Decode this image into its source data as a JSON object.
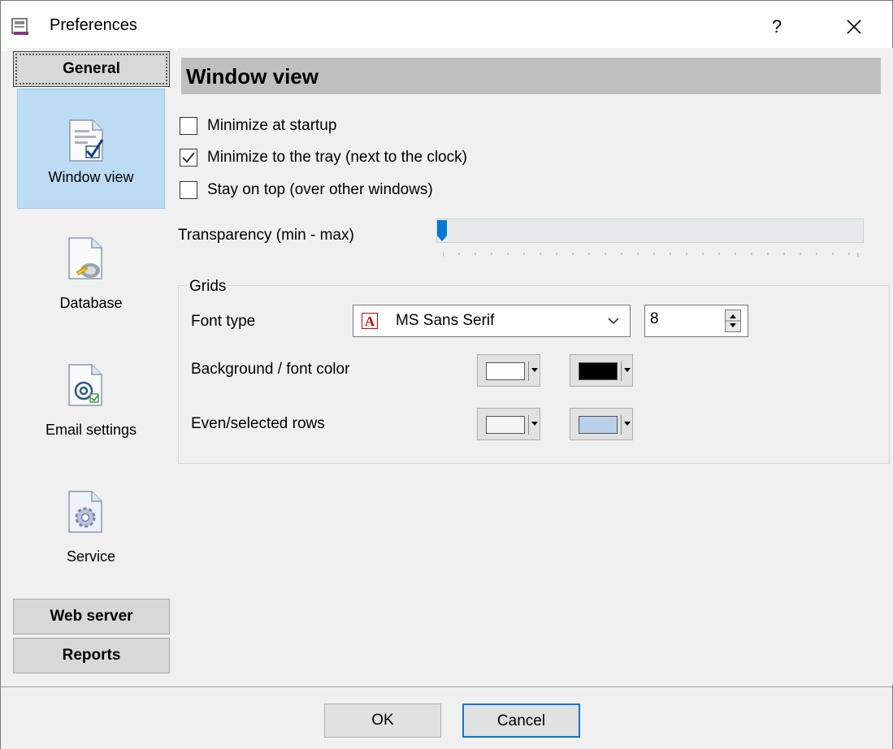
{
  "window": {
    "title": "Preferences",
    "help": "?"
  },
  "sidebar": {
    "general_label": "General",
    "items": [
      {
        "label": "Window view",
        "icon": "window-view-icon",
        "selected": true
      },
      {
        "label": "Database",
        "icon": "database-icon",
        "selected": false
      },
      {
        "label": "Email settings",
        "icon": "email-icon",
        "selected": false
      },
      {
        "label": "Service",
        "icon": "gear-icon",
        "selected": false
      }
    ],
    "web_server_label": "Web server",
    "reports_label": "Reports"
  },
  "content": {
    "header": "Window view",
    "checkboxes": [
      {
        "label": "Minimize at startup",
        "checked": false
      },
      {
        "label": "Minimize to the tray (next to the clock)",
        "checked": true
      },
      {
        "label": "Stay on top (over other windows)",
        "checked": false
      }
    ],
    "transparency": {
      "label": "Transparency (min - max)",
      "value": 0
    },
    "grids": {
      "title": "Grids",
      "font_type_label": "Font type",
      "font_name": "MS Sans Serif",
      "font_size": "8",
      "background_label": "Background / font color",
      "background_color": "#ffffff",
      "font_color": "#000000",
      "rows_label": "Even/selected rows",
      "even_color": "#f5f5f5",
      "selected_color": "#b9d1ea"
    }
  },
  "footer": {
    "ok": "OK",
    "cancel": "Cancel"
  },
  "colors": {
    "accent": "#0078d7",
    "selection": "#bcdcf4",
    "header_bar": "#bfbfbf"
  }
}
